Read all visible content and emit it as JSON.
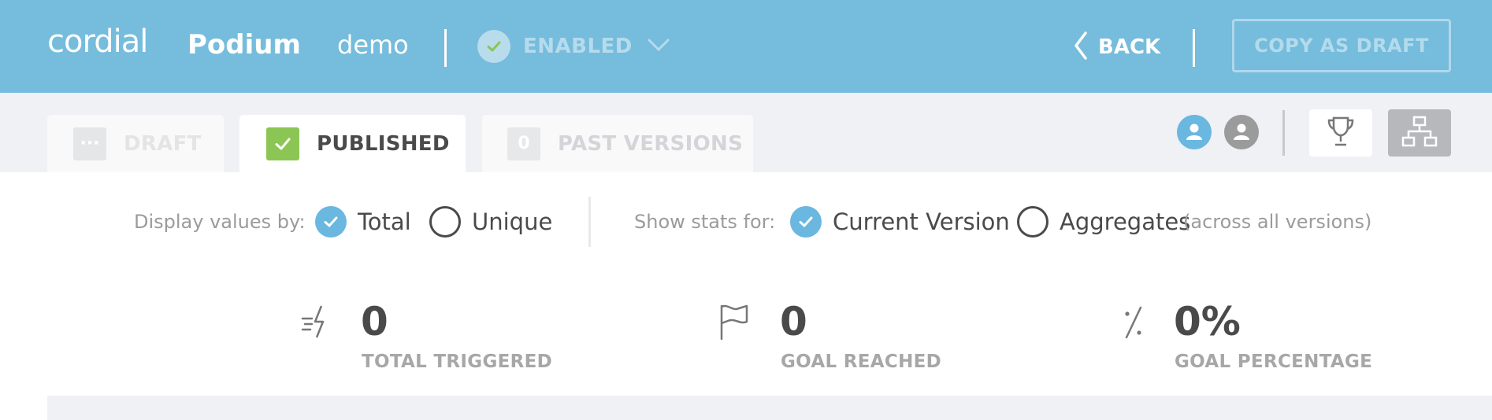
{
  "header": {
    "logo": "cordial",
    "app_name": "Podium",
    "campaign_name": "demo",
    "status_label": "ENABLED",
    "back_label": "BACK",
    "copy_label": "COPY AS DRAFT"
  },
  "tabs": {
    "draft": {
      "icon_text": "···",
      "label": "DRAFT"
    },
    "published": {
      "label": "PUBLISHED"
    },
    "past": {
      "count": "0",
      "label": "PAST VERSIONS"
    }
  },
  "filters": {
    "display_label": "Display values by:",
    "total": "Total",
    "unique": "Unique",
    "show_label": "Show stats for:",
    "current_version": "Current Version",
    "aggregates": "Aggregates",
    "aggregates_note": "(across all versions)",
    "display_selected": "Total",
    "show_selected": "Current Version"
  },
  "stats": {
    "triggered": {
      "value": "0",
      "caption": "TOTAL TRIGGERED"
    },
    "goal": {
      "value": "0",
      "caption": "GOAL REACHED"
    },
    "percentage": {
      "value": "0%",
      "caption": "GOAL PERCENTAGE"
    }
  },
  "icons": {
    "status": "check-circle-icon",
    "status_dropdown": "chevron-down-icon",
    "back": "chevron-left-icon",
    "user_active": "user-icon",
    "user_inactive": "user-icon",
    "trophy": "trophy-icon",
    "hierarchy": "sitemap-icon",
    "triggered": "lightning-icon",
    "goal": "flag-icon",
    "percentage": "percent-icon"
  },
  "colors": {
    "header_bg": "#76bcdc",
    "accent_blue": "#6ab7e0",
    "published_green": "#8bc553",
    "text_dark": "#4a4a4a",
    "text_muted": "#9b9b9b"
  }
}
